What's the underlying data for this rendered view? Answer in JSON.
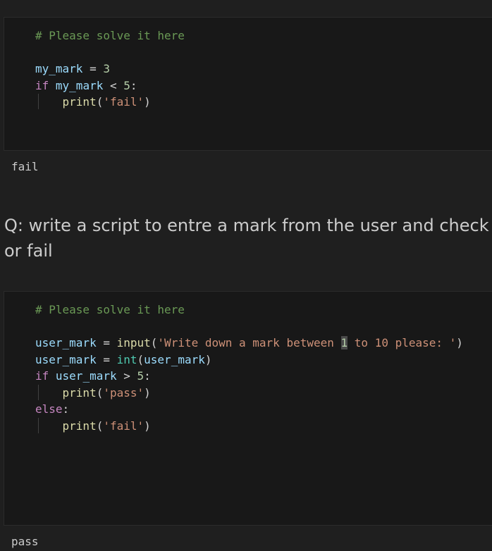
{
  "cell1": {
    "lines": [
      [
        {
          "t": "# Please solve it here",
          "c": "comment"
        }
      ],
      [],
      [
        {
          "t": "my_mark",
          "c": "var"
        },
        {
          "t": " = ",
          "c": "op"
        },
        {
          "t": "3",
          "c": "num"
        }
      ],
      [
        {
          "t": "if",
          "c": "kw"
        },
        {
          "t": " ",
          "c": "op"
        },
        {
          "t": "my_mark",
          "c": "var"
        },
        {
          "t": " < ",
          "c": "op"
        },
        {
          "t": "5",
          "c": "num"
        },
        {
          "t": ":",
          "c": "op"
        }
      ],
      [
        {
          "t": "    ",
          "c": "op"
        },
        {
          "t": "print",
          "c": "fn"
        },
        {
          "t": "(",
          "c": "op"
        },
        {
          "t": "'fail'",
          "c": "str"
        },
        {
          "t": ")",
          "c": "op"
        }
      ]
    ]
  },
  "output1": "fail",
  "question": {
    "line1": "Q: write a script to entre a mark from the user and check i",
    "line2": "or fail"
  },
  "cell2": {
    "lines": [
      [
        {
          "t": "# Please solve it here",
          "c": "comment"
        }
      ],
      [],
      [
        {
          "t": "user_mark",
          "c": "var"
        },
        {
          "t": " = ",
          "c": "op"
        },
        {
          "t": "input",
          "c": "fn"
        },
        {
          "t": "(",
          "c": "op"
        },
        {
          "t": "'Write down a mark between ",
          "c": "str"
        },
        {
          "t": "1",
          "c": "hl"
        },
        {
          "t": " to 10 please: '",
          "c": "str"
        },
        {
          "t": ")",
          "c": "op"
        }
      ],
      [
        {
          "t": "user_mark",
          "c": "var"
        },
        {
          "t": " = ",
          "c": "op"
        },
        {
          "t": "int",
          "c": "builtin"
        },
        {
          "t": "(",
          "c": "op"
        },
        {
          "t": "user_mark",
          "c": "var"
        },
        {
          "t": ")",
          "c": "op"
        }
      ],
      [
        {
          "t": "if",
          "c": "kw"
        },
        {
          "t": " ",
          "c": "op"
        },
        {
          "t": "user_mark",
          "c": "var"
        },
        {
          "t": " > ",
          "c": "op"
        },
        {
          "t": "5",
          "c": "num"
        },
        {
          "t": ":",
          "c": "op"
        }
      ],
      [
        {
          "t": "    ",
          "c": "op"
        },
        {
          "t": "print",
          "c": "fn"
        },
        {
          "t": "(",
          "c": "op"
        },
        {
          "t": "'pass'",
          "c": "str"
        },
        {
          "t": ")",
          "c": "op"
        }
      ],
      [
        {
          "t": "else",
          "c": "kw"
        },
        {
          "t": ":",
          "c": "op"
        }
      ],
      [
        {
          "t": "    ",
          "c": "op"
        },
        {
          "t": "print",
          "c": "fn"
        },
        {
          "t": "(",
          "c": "op"
        },
        {
          "t": "'fail'",
          "c": "str"
        },
        {
          "t": ")",
          "c": "op"
        }
      ]
    ]
  },
  "output2": "pass"
}
